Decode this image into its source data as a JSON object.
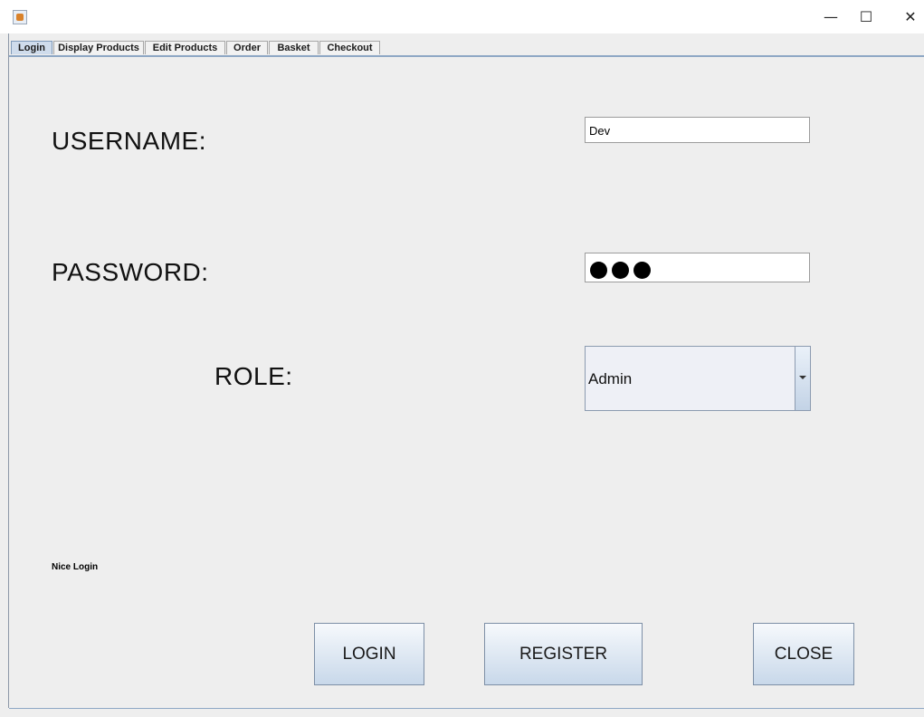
{
  "window": {
    "app_icon": "java-cup-icon",
    "minimize_glyph": "—",
    "maximize_glyph": "☐",
    "close_glyph": "✕"
  },
  "tabs": [
    {
      "label": "Login",
      "active": true
    },
    {
      "label": "Display Products",
      "active": false
    },
    {
      "label": "Edit Products",
      "active": false
    },
    {
      "label": "Order",
      "active": false
    },
    {
      "label": "Basket",
      "active": false
    },
    {
      "label": "Checkout",
      "active": false
    }
  ],
  "form": {
    "username_label": "USERNAME:",
    "username_value": "Dev",
    "password_label": "PASSWORD:",
    "password_length": 3,
    "role_label": "ROLE:",
    "role_value": "Admin"
  },
  "status_text": "Nice Login",
  "buttons": {
    "login": "LOGIN",
    "register": "REGISTER",
    "close": "CLOSE"
  },
  "colors": {
    "background": "#eeeeee",
    "tab_active": "#cfdcec",
    "accent_border": "#8ea7c5"
  }
}
